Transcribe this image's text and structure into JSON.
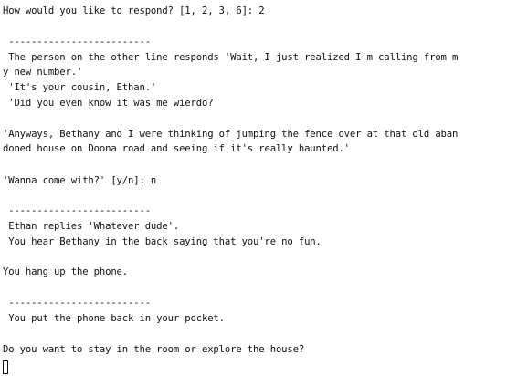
{
  "terminal": {
    "lines": [
      "How would you like to respond? [1, 2, 3, 6]: 2",
      " -------------------------",
      " The person on the other line responds 'Wait, I just realized I'm calling from m",
      "y new number.'",
      " 'It's your cousin, Ethan.'",
      " 'Did you even know it was me wierdo?'",
      "'Anyways, Bethany and I were thinking of jumping the fence over at that old aban",
      "doned house on Doona road and seeing if it's really haunted.'",
      "'Wanna come with?' [y/n]: n",
      " -------------------------",
      " Ethan replies 'Whatever dude'.",
      " You hear Bethany in the back saying that you're no fun.",
      "You hang up the phone.",
      " -------------------------",
      " You put the phone back in your pocket.",
      "Do you want to stay in the room or explore the house?"
    ]
  }
}
